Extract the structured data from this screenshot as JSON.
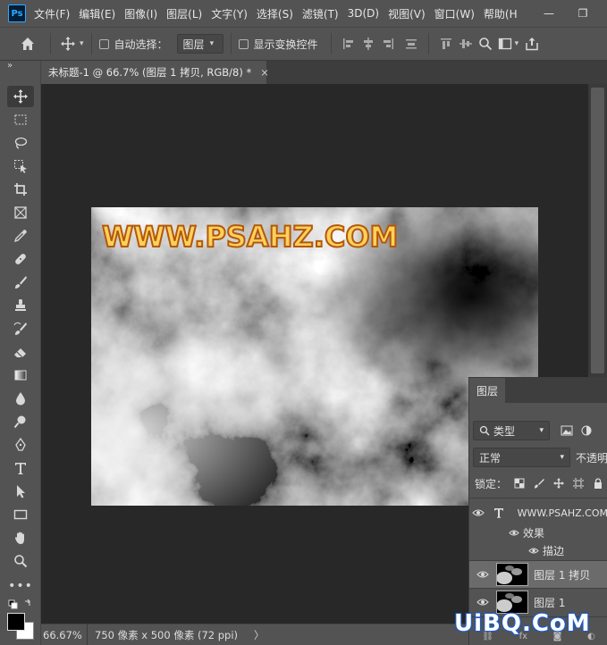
{
  "app": {
    "logo": "Ps"
  },
  "menu": [
    "文件(F)",
    "编辑(E)",
    "图像(I)",
    "图层(L)",
    "文字(Y)",
    "选择(S)",
    "滤镜(T)",
    "3D(D)",
    "视图(V)",
    "窗口(W)",
    "帮助(H"
  ],
  "window_controls": {
    "minimize": "—",
    "restore": "❐"
  },
  "options": {
    "auto_select_label": "自动选择：",
    "auto_select_value": "图层",
    "show_transform_label": "显示变换控件"
  },
  "document_tab": {
    "title": "未标题-1 @ 66.7% (图层 1 拷贝, RGB/8) *",
    "close": "×"
  },
  "canvas": {
    "text": "WWW.PSAHZ.COM"
  },
  "status": {
    "zoom": "66.67%",
    "info": "750 像素 x 500 像素 (72 ppi)",
    "chevron": "〉"
  },
  "layers_panel": {
    "tab": "图层",
    "filter_kind": "类型",
    "blend_mode": "正常",
    "opacity_label": "不透明",
    "lock_label": "锁定：",
    "layers": [
      {
        "name": "WWW.PSAHZ.COM",
        "type": "text",
        "selected": false
      },
      {
        "name": "效果",
        "type": "effects"
      },
      {
        "name": "描边",
        "type": "effect-item"
      },
      {
        "name": "图层 1 拷贝",
        "type": "pixel",
        "selected": true
      },
      {
        "name": "图层 1",
        "type": "pixel",
        "selected": false
      }
    ]
  },
  "watermark": "UiBQ.CoM",
  "colors": {
    "panel_bg": "#535353",
    "canvas_bg": "#282828",
    "text_fill": "#ffd05a",
    "text_stroke": "#b3580a",
    "ps_blue": "#31a8ff"
  }
}
